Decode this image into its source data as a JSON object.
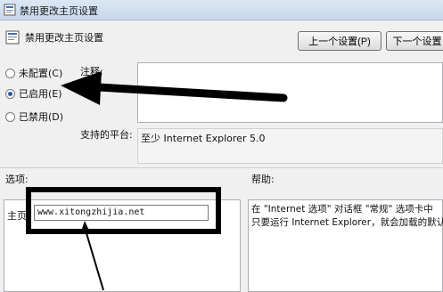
{
  "window": {
    "title": "禁用更改主页设置"
  },
  "policy": {
    "name": "禁用更改主页设置"
  },
  "buttons": {
    "prev": "上一个设置(P)",
    "next": "下一个设置"
  },
  "state": {
    "not_configured": "未配置(C)",
    "enabled": "已启用(E)",
    "disabled": "已禁用(D)",
    "selected": "enabled"
  },
  "comment": {
    "label": "注释:",
    "value": ""
  },
  "platform": {
    "label": "支持的平台:",
    "value": "至少 Internet Explorer 5.0"
  },
  "options": {
    "label": "选项:",
    "homepage_label": "主页",
    "homepage_value": "www.xitongzhijia.net"
  },
  "help": {
    "label": "帮助:",
    "lines": [
      "在 \"Internet 选项\" 对话框 \"常规\" 选项卡中",
      "只要运行 Internet Explorer，就会加载的默认"
    ]
  },
  "colors": {
    "title_bar": "#c6d7ea",
    "radio_dot": "#2a5aa8",
    "annotation": "#000000"
  }
}
